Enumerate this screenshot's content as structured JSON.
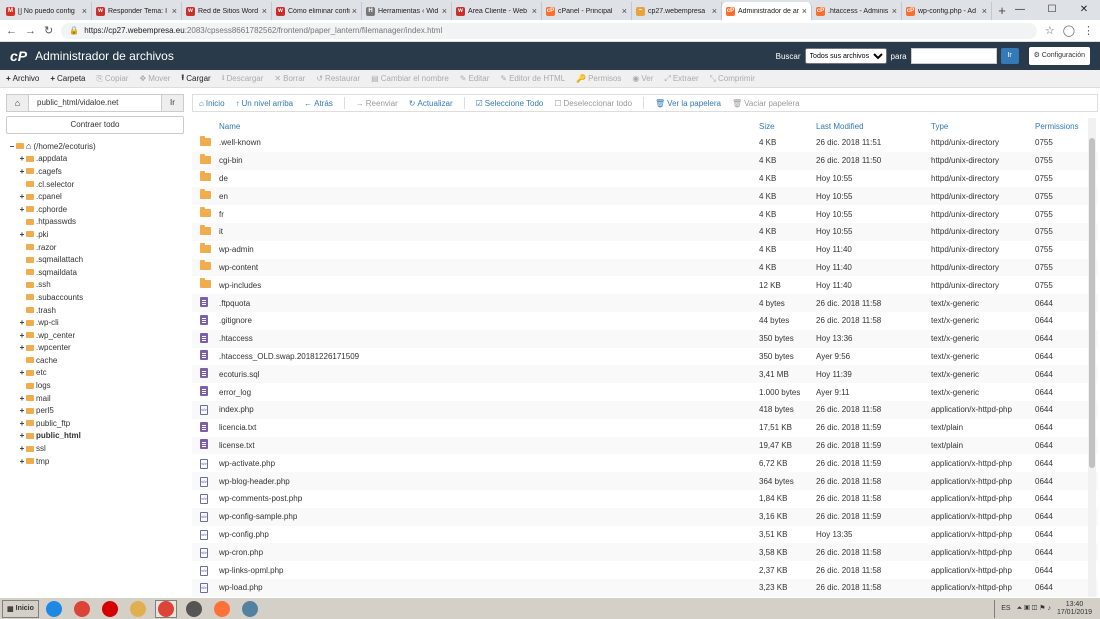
{
  "browser": {
    "tabs": [
      {
        "label": "[] No puedo config",
        "icon": "gmail-icon",
        "color": "#d93025",
        "text": "M"
      },
      {
        "label": "Responder Tema: I",
        "icon": "webempresa-icon",
        "color": "#c9302c",
        "text": "w"
      },
      {
        "label": "Red de Sitios Word",
        "icon": "webempresa-icon",
        "color": "#c9302c",
        "text": "w"
      },
      {
        "label": "Cómo eliminar confi",
        "icon": "webempresa-icon",
        "color": "#c9302c",
        "text": "w"
      },
      {
        "label": "Herramientas ‹ Wid",
        "icon": "tools-icon",
        "color": "#777777",
        "text": "H"
      },
      {
        "label": "Área Cliente - Web",
        "icon": "webempresa-icon",
        "color": "#c9302c",
        "text": "w"
      },
      {
        "label": "cPanel - Principal",
        "icon": "cpanel-icon",
        "color": "#ff6c2c",
        "text": "cP"
      },
      {
        "label": "cp27.webempresa",
        "icon": "chart-icon",
        "color": "#e8a33d",
        "text": "~"
      },
      {
        "label": "Administrador de ar",
        "icon": "cpanel-icon",
        "color": "#ff6c2c",
        "text": "cP",
        "active": true
      },
      {
        "label": ".htaccess - Adminis",
        "icon": "cpanel-icon",
        "color": "#ff6c2c",
        "text": "cP"
      },
      {
        "label": "wp-config.php - Ad",
        "icon": "cpanel-icon",
        "color": "#ff6c2c",
        "text": "cP"
      }
    ],
    "url_host": "https://cp27.webempresa.eu",
    "url_path": ":2083/cpsess8661782562/frontend/paper_lantern/filemanager/index.html"
  },
  "header": {
    "title": "Administrador de archivos",
    "logo": "cP",
    "search_label": "Buscar",
    "search_option": "Todos sus archivos",
    "for_label": "para",
    "go": "Ir",
    "settings": "Configuración"
  },
  "toolbar": [
    {
      "label": "Archivo",
      "icon": "+",
      "on": true
    },
    {
      "label": "Carpeta",
      "icon": "+",
      "on": true
    },
    {
      "label": "Copiar",
      "icon": "⎘",
      "on": false
    },
    {
      "label": "Mover",
      "icon": "✥",
      "on": false
    },
    {
      "label": "Cargar",
      "icon": "⭱",
      "on": true
    },
    {
      "label": "Descargar",
      "icon": "⭳",
      "on": false
    },
    {
      "label": "Borrar",
      "icon": "✕",
      "on": false
    },
    {
      "label": "Restaurar",
      "icon": "↺",
      "on": false
    },
    {
      "label": "Cambiar el nombre",
      "icon": "▤",
      "on": false
    },
    {
      "label": "Editar",
      "icon": "✎",
      "on": false
    },
    {
      "label": "Editor de HTML",
      "icon": "✎",
      "on": false
    },
    {
      "label": "Permisos",
      "icon": "🔑",
      "on": false
    },
    {
      "label": "Ver",
      "icon": "◉",
      "on": false
    },
    {
      "label": "Extraer",
      "icon": "⤢",
      "on": false
    },
    {
      "label": "Comprimir",
      "icon": "⤡",
      "on": false
    }
  ],
  "left": {
    "path": "public_html/vidaloe.net",
    "go": "Ir",
    "collapse": "Contraer todo"
  },
  "tree": [
    {
      "label": "(/home2/ecoturis)",
      "toggle": "−",
      "level": 0,
      "home": true
    },
    {
      "label": ".appdata",
      "toggle": "+",
      "level": 1
    },
    {
      "label": ".cagefs",
      "toggle": "+",
      "level": 1
    },
    {
      "label": ".cl.selector",
      "toggle": "",
      "level": 1
    },
    {
      "label": ".cpanel",
      "toggle": "+",
      "level": 1
    },
    {
      "label": ".cphorde",
      "toggle": "+",
      "level": 1
    },
    {
      "label": ".htpasswds",
      "toggle": "",
      "level": 1
    },
    {
      "label": ".pki",
      "toggle": "+",
      "level": 1
    },
    {
      "label": ".razor",
      "toggle": "",
      "level": 1
    },
    {
      "label": ".sqmailattach",
      "toggle": "",
      "level": 1
    },
    {
      "label": ".sqmaildata",
      "toggle": "",
      "level": 1
    },
    {
      "label": ".ssh",
      "toggle": "",
      "level": 1
    },
    {
      "label": ".subaccounts",
      "toggle": "",
      "level": 1
    },
    {
      "label": ".trash",
      "toggle": "",
      "level": 1
    },
    {
      "label": ".wp-cli",
      "toggle": "+",
      "level": 1
    },
    {
      "label": ".wp_center",
      "toggle": "+",
      "level": 1
    },
    {
      "label": ".wpcenter",
      "toggle": "+",
      "level": 1
    },
    {
      "label": "cache",
      "toggle": "",
      "level": 1
    },
    {
      "label": "etc",
      "toggle": "+",
      "level": 1
    },
    {
      "label": "logs",
      "toggle": "",
      "level": 1
    },
    {
      "label": "mail",
      "toggle": "+",
      "level": 1
    },
    {
      "label": "perl5",
      "toggle": "+",
      "level": 1
    },
    {
      "label": "public_ftp",
      "toggle": "+",
      "level": 1
    },
    {
      "label": "public_html",
      "toggle": "+",
      "level": 1,
      "bold": true
    },
    {
      "label": "ssl",
      "toggle": "+",
      "level": 1
    },
    {
      "label": "tmp",
      "toggle": "+",
      "level": 1
    }
  ],
  "navbar": [
    {
      "label": "Inicio",
      "icon": "⌂",
      "dis": false
    },
    {
      "label": "Un nivel arriba",
      "icon": "↑",
      "dis": false
    },
    {
      "label": "Atrás",
      "icon": "←",
      "dis": false
    },
    {
      "label": "Reenviar",
      "icon": "→",
      "dis": true
    },
    {
      "label": "Actualizar",
      "icon": "↻",
      "dis": false
    },
    {
      "label": "Seleccione Todo",
      "icon": "☑",
      "dis": false
    },
    {
      "label": "Deseleccionar todo",
      "icon": "☐",
      "dis": true
    },
    {
      "label": "Ver la papelera",
      "icon": "🗑",
      "dis": false
    },
    {
      "label": "Vaciar papelera",
      "icon": "🗑",
      "dis": true
    }
  ],
  "columns": {
    "name": "Name",
    "size": "Size",
    "modified": "Last Modified",
    "type": "Type",
    "perms": "Permissions"
  },
  "files": [
    {
      "kind": "folder",
      "name": ".well-known",
      "size": "4 KB",
      "modified": "26 dic. 2018 11:51",
      "type": "httpd/unix-directory",
      "perms": "0755"
    },
    {
      "kind": "folder",
      "name": "cgi-bin",
      "size": "4 KB",
      "modified": "26 dic. 2018 11:50",
      "type": "httpd/unix-directory",
      "perms": "0755"
    },
    {
      "kind": "folder",
      "name": "de",
      "size": "4 KB",
      "modified": "Hoy 10:55",
      "type": "httpd/unix-directory",
      "perms": "0755"
    },
    {
      "kind": "folder",
      "name": "en",
      "size": "4 KB",
      "modified": "Hoy 10:55",
      "type": "httpd/unix-directory",
      "perms": "0755"
    },
    {
      "kind": "folder",
      "name": "fr",
      "size": "4 KB",
      "modified": "Hoy 10:55",
      "type": "httpd/unix-directory",
      "perms": "0755"
    },
    {
      "kind": "folder",
      "name": "it",
      "size": "4 KB",
      "modified": "Hoy 10:55",
      "type": "httpd/unix-directory",
      "perms": "0755"
    },
    {
      "kind": "folder",
      "name": "wp-admin",
      "size": "4 KB",
      "modified": "Hoy 11:40",
      "type": "httpd/unix-directory",
      "perms": "0755"
    },
    {
      "kind": "folder",
      "name": "wp-content",
      "size": "4 KB",
      "modified": "Hoy 11:40",
      "type": "httpd/unix-directory",
      "perms": "0755"
    },
    {
      "kind": "folder",
      "name": "wp-includes",
      "size": "12 KB",
      "modified": "Hoy 11:40",
      "type": "httpd/unix-directory",
      "perms": "0755"
    },
    {
      "kind": "doc",
      "name": ".ftpquota",
      "size": "4 bytes",
      "modified": "26 dic. 2018 11:58",
      "type": "text/x-generic",
      "perms": "0644"
    },
    {
      "kind": "doc",
      "name": ".gitignore",
      "size": "44 bytes",
      "modified": "26 dic. 2018 11:58",
      "type": "text/x-generic",
      "perms": "0644"
    },
    {
      "kind": "doc",
      "name": ".htaccess",
      "size": "350 bytes",
      "modified": "Hoy 13:36",
      "type": "text/x-generic",
      "perms": "0644"
    },
    {
      "kind": "doc",
      "name": ".htaccess_OLD.swap.20181226171509",
      "size": "350 bytes",
      "modified": "Ayer 9:56",
      "type": "text/x-generic",
      "perms": "0644"
    },
    {
      "kind": "doc",
      "name": "ecoturis.sql",
      "size": "3,41 MB",
      "modified": "Hoy 11:39",
      "type": "text/x-generic",
      "perms": "0644"
    },
    {
      "kind": "doc",
      "name": "error_log",
      "size": "1.000 bytes",
      "modified": "Ayer 9:11",
      "type": "text/x-generic",
      "perms": "0644"
    },
    {
      "kind": "code",
      "name": "index.php",
      "size": "418 bytes",
      "modified": "26 dic. 2018 11:58",
      "type": "application/x-httpd-php",
      "perms": "0644"
    },
    {
      "kind": "doc",
      "name": "licencia.txt",
      "size": "17,51 KB",
      "modified": "26 dic. 2018 11:59",
      "type": "text/plain",
      "perms": "0644"
    },
    {
      "kind": "doc",
      "name": "license.txt",
      "size": "19,47 KB",
      "modified": "26 dic. 2018 11:59",
      "type": "text/plain",
      "perms": "0644"
    },
    {
      "kind": "code",
      "name": "wp-activate.php",
      "size": "6,72 KB",
      "modified": "26 dic. 2018 11:59",
      "type": "application/x-httpd-php",
      "perms": "0644"
    },
    {
      "kind": "code",
      "name": "wp-blog-header.php",
      "size": "364 bytes",
      "modified": "26 dic. 2018 11:58",
      "type": "application/x-httpd-php",
      "perms": "0644"
    },
    {
      "kind": "code",
      "name": "wp-comments-post.php",
      "size": "1,84 KB",
      "modified": "26 dic. 2018 11:58",
      "type": "application/x-httpd-php",
      "perms": "0644"
    },
    {
      "kind": "code",
      "name": "wp-config-sample.php",
      "size": "3,16 KB",
      "modified": "26 dic. 2018 11:59",
      "type": "application/x-httpd-php",
      "perms": "0644"
    },
    {
      "kind": "code",
      "name": "wp-config.php",
      "size": "3,51 KB",
      "modified": "Hoy 13:35",
      "type": "application/x-httpd-php",
      "perms": "0644"
    },
    {
      "kind": "code",
      "name": "wp-cron.php",
      "size": "3,58 KB",
      "modified": "26 dic. 2018 11:58",
      "type": "application/x-httpd-php",
      "perms": "0644"
    },
    {
      "kind": "code",
      "name": "wp-links-opml.php",
      "size": "2,37 KB",
      "modified": "26 dic. 2018 11:58",
      "type": "application/x-httpd-php",
      "perms": "0644"
    },
    {
      "kind": "code",
      "name": "wp-load.php",
      "size": "3,23 KB",
      "modified": "26 dic. 2018 11:58",
      "type": "application/x-httpd-php",
      "perms": "0644"
    }
  ],
  "taskbar": {
    "start": "Inicio",
    "lang": "ES",
    "time": "13:40",
    "date": "17/01/2019",
    "apps": [
      {
        "icon": "ie-icon",
        "color": "#1e88e5"
      },
      {
        "icon": "chrome-icon",
        "color": "#db4437"
      },
      {
        "icon": "opera-icon",
        "color": "#d50000"
      },
      {
        "icon": "explorer-icon",
        "color": "#e0b050"
      },
      {
        "icon": "chrome-icon",
        "color": "#db4437",
        "active": true
      },
      {
        "icon": "atm-icon",
        "color": "#555555"
      },
      {
        "icon": "firefox-icon",
        "color": "#ff7139"
      },
      {
        "icon": "java-icon",
        "color": "#5382a1"
      }
    ]
  }
}
